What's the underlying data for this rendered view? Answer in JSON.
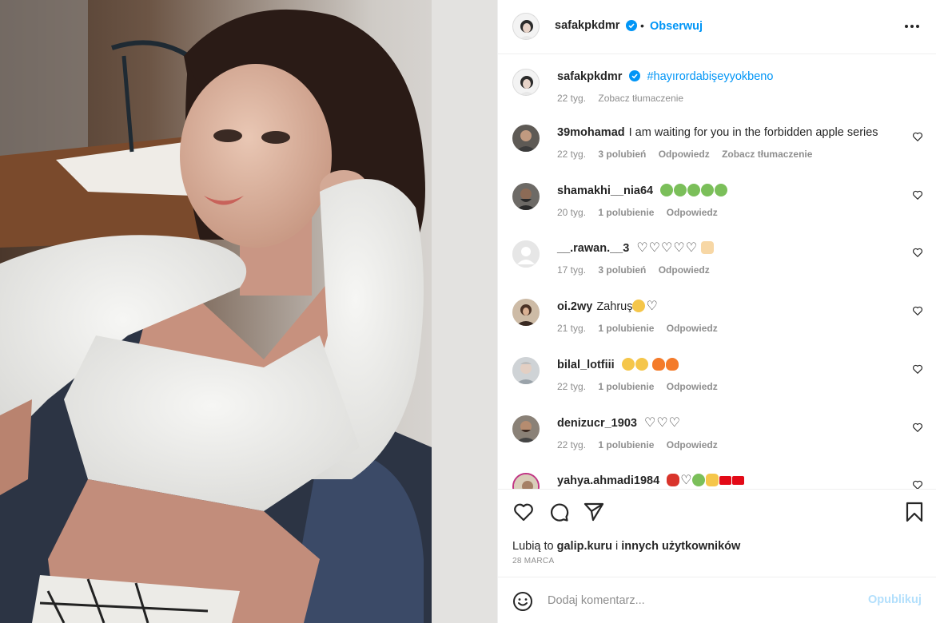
{
  "post": {
    "author": "safakpkdmr",
    "follow_label": "Obserwuj",
    "separator": "•",
    "caption_hashtag": "#hayırordabişeyyokbeno",
    "caption_time": "22 tyg.",
    "caption_translate": "Zobacz tłumaczenie"
  },
  "comments": [
    {
      "user": "39mohamad",
      "text": "I am waiting for you in the forbidden apple series",
      "time": "22 tyg.",
      "likes": "3 polubień",
      "reply": "Odpowiedz",
      "translate": "Zobacz tłumaczenie"
    },
    {
      "user": "shamakhi__nia64",
      "text": "",
      "time": "20 tyg.",
      "likes": "1 polubienie",
      "reply": "Odpowiedz"
    },
    {
      "user": "__.rawan.__3",
      "text": "",
      "time": "17 tyg.",
      "likes": "3 polubień",
      "reply": "Odpowiedz"
    },
    {
      "user": "oi.2wy",
      "text": "Zahruş",
      "time": "21 tyg.",
      "likes": "1 polubienie",
      "reply": "Odpowiedz"
    },
    {
      "user": "bilal_lotfiii",
      "text": "",
      "time": "22 tyg.",
      "likes": "1 polubienie",
      "reply": "Odpowiedz"
    },
    {
      "user": "denizucr_1903",
      "text": "",
      "time": "22 tyg.",
      "likes": "1 polubienie",
      "reply": "Odpowiedz"
    },
    {
      "user": "yahya.ahmadi1984",
      "text": "",
      "time": "",
      "likes": "",
      "reply": ""
    }
  ],
  "likes_line": {
    "prefix": "Lubią to",
    "user": "galip.kuru",
    "connector": "i",
    "others": "innych użytkowników"
  },
  "date": "28 MARCA",
  "composer": {
    "placeholder": "Dodaj komentarz...",
    "post_label": "Opublikuj"
  },
  "icons": {
    "more": "more-options-icon",
    "like": "heart-icon",
    "comment": "comment-icon",
    "share": "send-icon",
    "save": "bookmark-icon",
    "emoji": "emoji-icon",
    "verified": "verified-badge-icon"
  },
  "colors": {
    "link": "#0095f6",
    "muted": "#8e8e8e",
    "text": "#262626",
    "post_disabled": "#b2dffc"
  }
}
